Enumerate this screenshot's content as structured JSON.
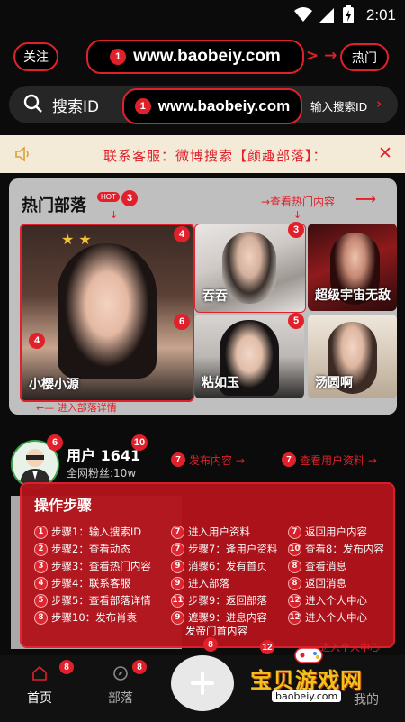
{
  "status": {
    "time": "2:01"
  },
  "header": {
    "follow_label": "关注",
    "url": "www.baobeiy.com",
    "hot_label": "热门",
    "badge_1": "1"
  },
  "search": {
    "label": "搜索ID",
    "url": "www.baobeiy.com",
    "input_hint": "输入搜索ID",
    "badge": "1"
  },
  "notice": {
    "text": "联系客服：微博搜索【颜趣部落】："
  },
  "hot": {
    "title": "热门部落",
    "tag": "HOT",
    "badge_3": "3",
    "view_hot": "→查看热门内容",
    "enter_detail": "←— 进入部落详情",
    "cards": [
      {
        "name": "小樱小源",
        "badge": "4"
      },
      {
        "name": "吞吞",
        "badge": "3"
      },
      {
        "name": "超级宇宙无敌",
        "badge": ""
      },
      {
        "name": "粘如玉",
        "badge": "5"
      },
      {
        "name": "汤圆啊",
        "badge": ""
      }
    ],
    "badge_6": "6",
    "badge_4b": "4"
  },
  "user": {
    "name": "用户 1641",
    "fans": "全网粉丝:10w",
    "badge_6": "6",
    "badge_10": "10",
    "publish": "发布内容 →",
    "view_profile": "查看用户资料 →",
    "badge_7": "7"
  },
  "steps": {
    "title": "操作步骤",
    "col1": [
      {
        "n": "1",
        "t": "步骤1：输入搜索ID"
      },
      {
        "n": "2",
        "t": "步骤2：查看动态"
      },
      {
        "n": "3",
        "t": "步骤3：查看热门内容"
      },
      {
        "n": "4",
        "t": "步骤4：联系客服"
      },
      {
        "n": "5",
        "t": "步骤5：查看部落详情"
      },
      {
        "n": "8",
        "t": "步骤10：发布肖袁"
      }
    ],
    "col2": [
      {
        "n": "7",
        "t": "进入用户资料"
      },
      {
        "n": "7",
        "t": "步骤7：逢用户资料"
      },
      {
        "n": "9",
        "t": "消骤6：发有首页"
      },
      {
        "n": "9",
        "t": "进入部落"
      },
      {
        "n": "11",
        "t": "步骤9：返回部落"
      },
      {
        "n": "9",
        "t": "遮骤9：进息内容"
      }
    ],
    "col3": [
      {
        "n": "7",
        "t": "返回用户内容"
      },
      {
        "n": "10",
        "t": "查看8：发布内容"
      },
      {
        "n": "8",
        "t": "查看消息"
      },
      {
        "n": "8",
        "t": "返回消息"
      },
      {
        "n": "12",
        "t": "进入个人中心"
      },
      {
        "n": "12",
        "t": "进入个人中心"
      }
    ],
    "extra": "发帝门首内容",
    "extra_badge": "8",
    "badge_12": "12",
    "enter_center": "进入个人中心"
  },
  "nav": {
    "home": "首页",
    "tribe": "部落",
    "mine": "我的",
    "badge_home": "8",
    "badge_tribe": "8"
  },
  "watermark": {
    "title": "宝贝游戏网",
    "url": "baobeiy.com"
  }
}
